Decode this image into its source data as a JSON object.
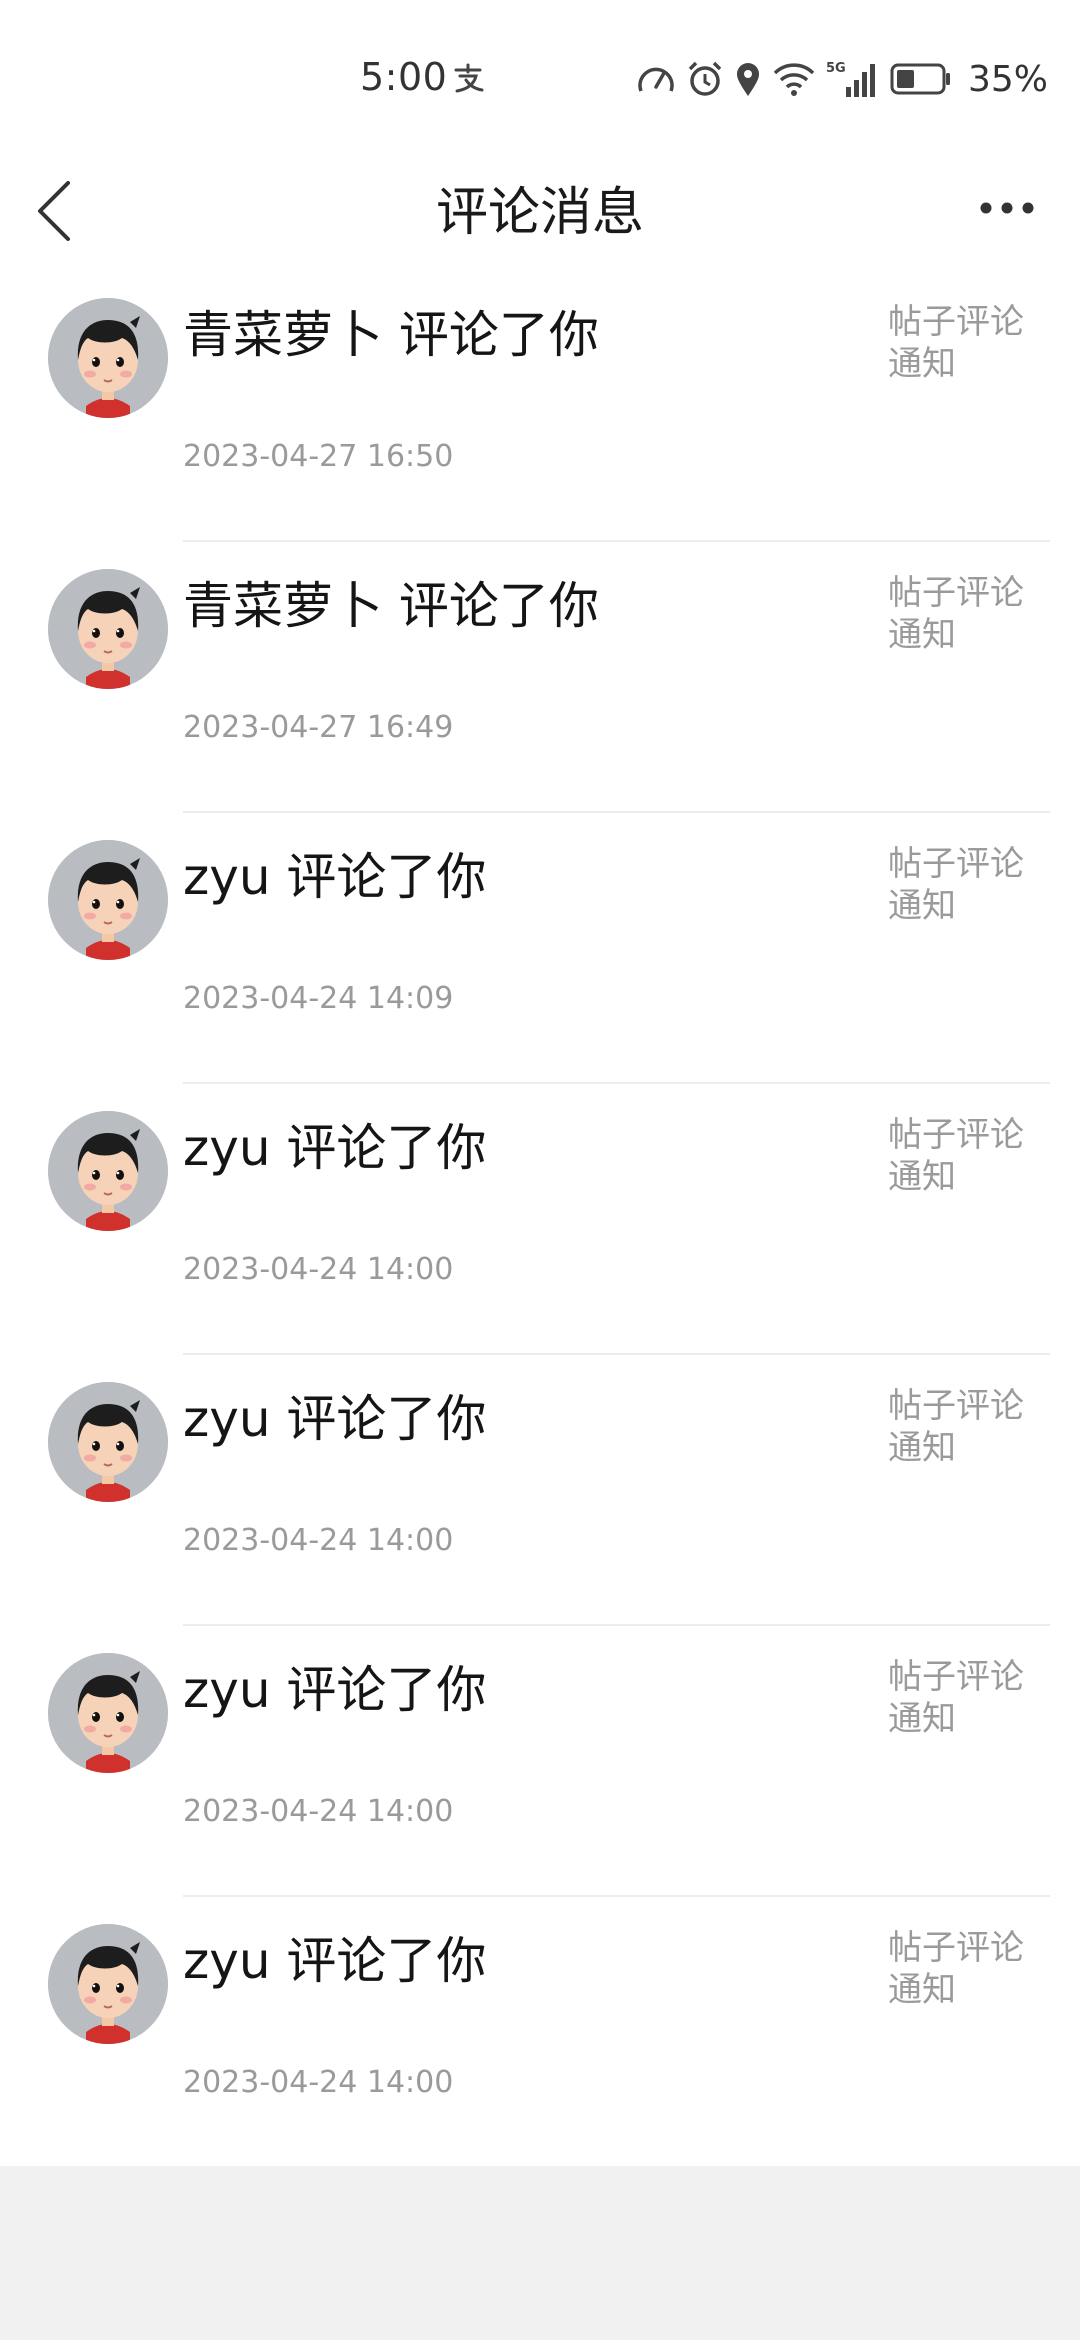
{
  "status_bar": {
    "time": "5:00",
    "icons": [
      "alipay-icon",
      "speedometer-icon",
      "alarm-icon",
      "location-icon",
      "wifi-icon",
      "5g-signal-icon",
      "battery-icon"
    ],
    "network_label": "5G",
    "battery_percent": "35%"
  },
  "header": {
    "title": "评论消息",
    "back_icon": "chevron-left-icon",
    "more_icon": "more-dots-icon"
  },
  "messages": [
    {
      "title": "青菜萝卜 评论了你",
      "type": "帖子评论通知",
      "time": "2023-04-27 16:50",
      "avatar": "cartoon-avatar-gray"
    },
    {
      "title": "青菜萝卜 评论了你",
      "type": "帖子评论通知",
      "time": "2023-04-27 16:49",
      "avatar": "cartoon-avatar-gray"
    },
    {
      "title": "zyu 评论了你",
      "type": "帖子评论通知",
      "time": "2023-04-24 14:09",
      "avatar": "cartoon-avatar-gray"
    },
    {
      "title": "zyu 评论了你",
      "type": "帖子评论通知",
      "time": "2023-04-24 14:00",
      "avatar": "cartoon-avatar-gray"
    },
    {
      "title": "zyu 评论了你",
      "type": "帖子评论通知",
      "time": "2023-04-24 14:00",
      "avatar": "cartoon-avatar-gray"
    },
    {
      "title": "zyu 评论了你",
      "type": "帖子评论通知",
      "time": "2023-04-24 14:00",
      "avatar": "cartoon-avatar-gray"
    },
    {
      "title": "zyu 评论了你",
      "type": "帖子评论通知",
      "time": "2023-04-24 14:00",
      "avatar": "cartoon-avatar-gray"
    }
  ],
  "colors": {
    "primary_text": "#151515",
    "secondary_text": "#9a9a9a",
    "divider": "#ececec",
    "background": "#ffffff",
    "footer_background": "#f1f1f1"
  }
}
